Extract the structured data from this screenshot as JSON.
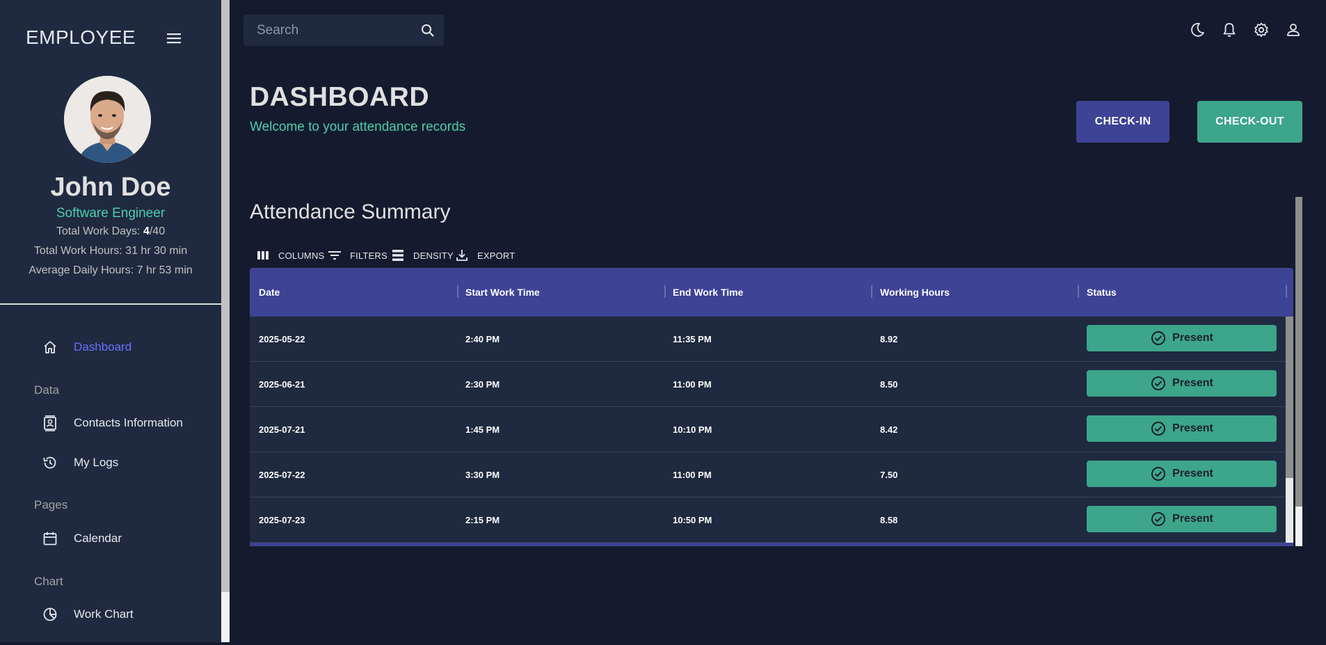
{
  "sidebar": {
    "brand": "EMPLOYEE",
    "profile": {
      "name": "John Doe",
      "role": "Software Engineer",
      "work_days_label": "Total Work Days: ",
      "work_days_value": "4",
      "work_days_total": "/40",
      "work_hours": "Total Work Hours: 31 hr 30 min",
      "avg_hours": "Average Daily Hours: 7 hr 53 min"
    },
    "nav": {
      "dashboard": "Dashboard",
      "section_data": "Data",
      "contacts": "Contacts Information",
      "logs": "My Logs",
      "section_pages": "Pages",
      "calendar": "Calendar",
      "section_chart": "Chart",
      "work_chart": "Work Chart"
    }
  },
  "topbar": {
    "search_placeholder": "Search"
  },
  "header": {
    "title": "DASHBOARD",
    "subtitle": "Welcome to your attendance records",
    "checkin": "CHECK-IN",
    "checkout": "CHECK-OUT"
  },
  "summary": {
    "title": "Attendance Summary",
    "toolbar": {
      "columns": "COLUMNS",
      "filters": "FILTERS",
      "density": "DENSITY",
      "export": "EXPORT"
    },
    "columns": {
      "date": "Date",
      "start": "Start Work Time",
      "end": "End Work Time",
      "hours": "Working Hours",
      "status": "Status"
    },
    "rows": [
      {
        "date": "2025-05-22",
        "start": "2:40 PM",
        "end": "11:35 PM",
        "hours": "8.92",
        "status": "Present"
      },
      {
        "date": "2025-06-21",
        "start": "2:30 PM",
        "end": "11:00 PM",
        "hours": "8.50",
        "status": "Present"
      },
      {
        "date": "2025-07-21",
        "start": "1:45 PM",
        "end": "10:10 PM",
        "hours": "8.42",
        "status": "Present"
      },
      {
        "date": "2025-07-22",
        "start": "3:30 PM",
        "end": "11:00 PM",
        "hours": "7.50",
        "status": "Present"
      },
      {
        "date": "2025-07-23",
        "start": "2:15 PM",
        "end": "10:50 PM",
        "hours": "8.58",
        "status": "Present"
      }
    ]
  },
  "colors": {
    "accent_primary": "#3e4396",
    "accent_green": "#4cceac",
    "status_green": "#3da58a",
    "active_nav": "#6870fa",
    "background": "#151b2e",
    "panel": "#1f2a40"
  }
}
